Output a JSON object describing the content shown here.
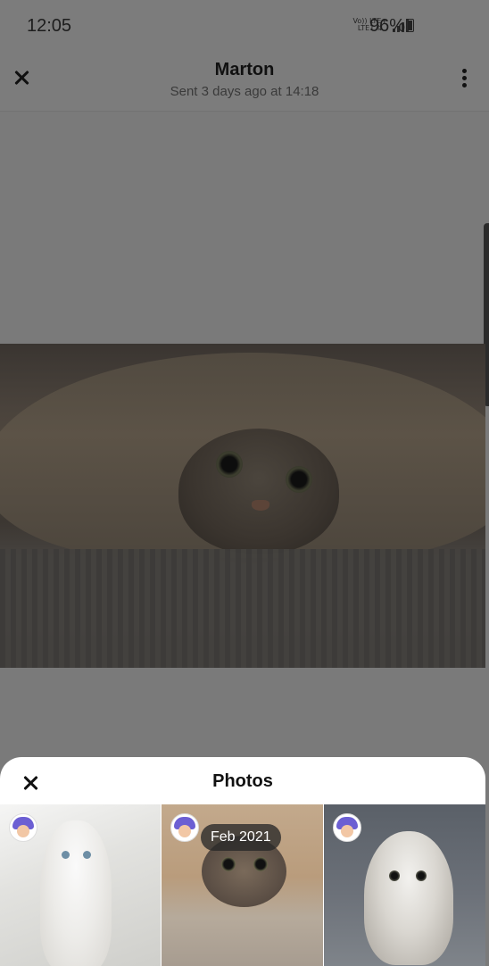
{
  "status_bar": {
    "time": "12:05",
    "net_top": "Vo)) LTE+",
    "net_bottom": "LTE1 ⇅",
    "battery": "96%"
  },
  "header": {
    "title": "Marton",
    "subtitle": "Sent 3 days ago at 14:18"
  },
  "sheet": {
    "title": "Photos",
    "thumbnails": [
      {
        "label": ""
      },
      {
        "label": "Feb 2021"
      },
      {
        "label": ""
      }
    ]
  }
}
